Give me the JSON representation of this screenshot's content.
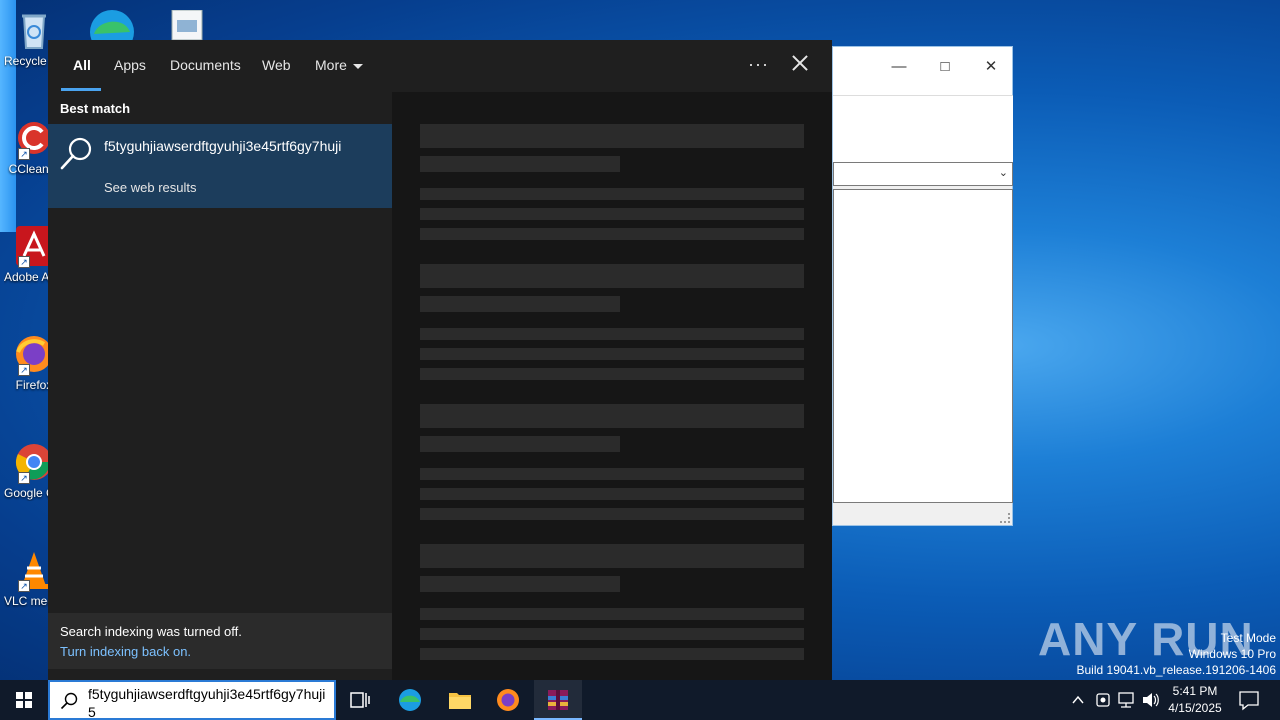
{
  "desktop": {
    "icons": [
      {
        "label": "Recycle Bin"
      },
      {
        "label": "CCleaner"
      },
      {
        "label": "Adobe Acrobat"
      },
      {
        "label": "Firefox"
      },
      {
        "label": "Google Chrome"
      },
      {
        "label": "VLC media player"
      }
    ]
  },
  "search": {
    "tabs": [
      {
        "label": "All"
      },
      {
        "label": "Apps"
      },
      {
        "label": "Documents"
      },
      {
        "label": "Web"
      },
      {
        "label": "More"
      }
    ],
    "more_options": "···",
    "best_match_header": "Best match",
    "best_match": {
      "title": "f5tyguhjiawserdftgyuhji3e45rtf6gy7huji",
      "subtitle": "See web results"
    },
    "indexing": {
      "message": "Search indexing was turned off.",
      "link": "Turn indexing back on."
    },
    "query": "f5tyguhjiawserdftgyuhji3e45rtf6gy7huji5"
  },
  "taskbar": {
    "clock": {
      "time": "5:41 PM",
      "date": "4/15/2025"
    }
  },
  "watermark": {
    "brand": "ANY RUN",
    "line1": "Test Mode",
    "line2": "Windows 10 Pro",
    "line3": "Build 19041.vb_release.191206-1406"
  },
  "colors": {
    "accent": "#4aa3ef",
    "selection": "#1c3d5c",
    "link": "#7cc1ff"
  }
}
